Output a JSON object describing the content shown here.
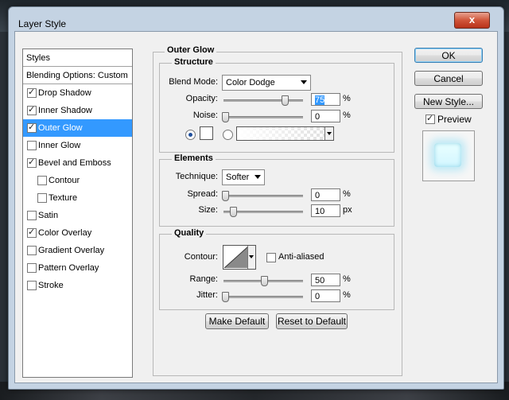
{
  "window": {
    "title": "Layer Style",
    "close_glyph": "x"
  },
  "styles_list": {
    "header": "Styles",
    "blending": "Blending Options: Custom",
    "items": [
      {
        "label": "Drop Shadow",
        "checked": true
      },
      {
        "label": "Inner Shadow",
        "checked": true
      },
      {
        "label": "Outer Glow",
        "checked": true
      },
      {
        "label": "Inner Glow",
        "checked": false
      },
      {
        "label": "Bevel and Emboss",
        "checked": true
      },
      {
        "label": "Contour",
        "checked": false
      },
      {
        "label": "Texture",
        "checked": false
      },
      {
        "label": "Satin",
        "checked": false
      },
      {
        "label": "Color Overlay",
        "checked": true
      },
      {
        "label": "Gradient Overlay",
        "checked": false
      },
      {
        "label": "Pattern Overlay",
        "checked": false
      },
      {
        "label": "Stroke",
        "checked": false
      }
    ],
    "selected": "Outer Glow"
  },
  "panel": {
    "title": "Outer Glow",
    "structure": {
      "label": "Structure",
      "blend_mode_label": "Blend Mode:",
      "blend_mode_value": "Color Dodge",
      "opacity_label": "Opacity:",
      "opacity_value": "75",
      "noise_label": "Noise:",
      "noise_value": "0",
      "unit": "%"
    },
    "elements": {
      "label": "Elements",
      "technique_label": "Technique:",
      "technique_value": "Softer",
      "spread_label": "Spread:",
      "spread_value": "0",
      "size_label": "Size:",
      "size_value": "10",
      "pct": "%",
      "px": "px"
    },
    "quality": {
      "label": "Quality",
      "contour_label": "Contour:",
      "anti_aliased_label": "Anti-aliased",
      "range_label": "Range:",
      "range_value": "50",
      "jitter_label": "Jitter:",
      "jitter_value": "0",
      "unit": "%"
    },
    "make_default": "Make Default",
    "reset_default": "Reset to Default"
  },
  "actions": {
    "ok": "OK",
    "cancel": "Cancel",
    "new_style": "New Style...",
    "preview": "Preview"
  },
  "colors": {
    "selection": "#3399ff",
    "glow": "#ffffff"
  }
}
